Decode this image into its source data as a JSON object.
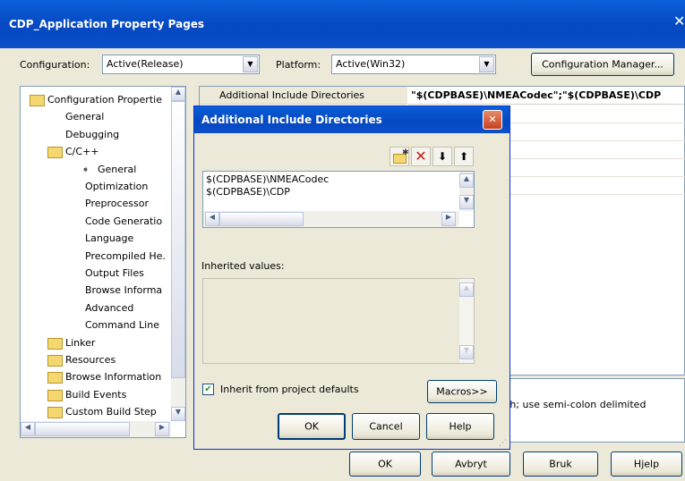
{
  "window": {
    "title": "CDP_Application Property Pages",
    "close_glyph": "✕"
  },
  "toolbar": {
    "configuration_label": "Configuration:",
    "configuration_value": "Active(Release)",
    "platform_label": "Platform:",
    "platform_value": "Active(Win32)",
    "config_manager_label": "Configuration Manager..."
  },
  "tree": {
    "items": [
      {
        "label": "Configuration Propertie",
        "icon": "folder-open-icon"
      },
      {
        "label": "General"
      },
      {
        "label": "Debugging"
      },
      {
        "label": "C/C++",
        "icon": "folder-open-icon"
      },
      {
        "label": "General",
        "selected": true,
        "icon": "arrow-right-icon"
      },
      {
        "label": "Optimization"
      },
      {
        "label": "Preprocessor"
      },
      {
        "label": "Code Generatio"
      },
      {
        "label": "Language"
      },
      {
        "label": "Precompiled He."
      },
      {
        "label": "Output Files"
      },
      {
        "label": "Browse Informa"
      },
      {
        "label": "Advanced"
      },
      {
        "label": "Command Line"
      },
      {
        "label": "Linker",
        "icon": "folder-icon"
      },
      {
        "label": "Resources",
        "icon": "folder-icon"
      },
      {
        "label": "Browse Information",
        "icon": "folder-icon"
      },
      {
        "label": "Build Events",
        "icon": "folder-icon"
      },
      {
        "label": "Custom Build Step",
        "icon": "folder-icon"
      }
    ]
  },
  "grid": {
    "row0_name": "Additional Include Directories",
    "row0_value": "\"$(CDPBASE)\\NMEACodec\";\"$(CDPBASE)\\CDP"
  },
  "description": {
    "text": "th; use semi-colon delimited"
  },
  "dialog": {
    "title": "Additional Include Directories",
    "entries": [
      "$(CDPBASE)\\NMEACodec",
      "$(CDPBASE)\\CDP"
    ],
    "inherited_label": "Inherited values:",
    "inherit_checkbox_label": "Inherit from project defaults",
    "inherit_checked": "✔",
    "macros_label": "Macros>>",
    "ok_label": "OK",
    "cancel_label": "Cancel",
    "help_label": "Help"
  },
  "buttons": {
    "ok": "OK",
    "cancel": "Avbryt",
    "apply": "Bruk",
    "help": "Hjelp"
  }
}
